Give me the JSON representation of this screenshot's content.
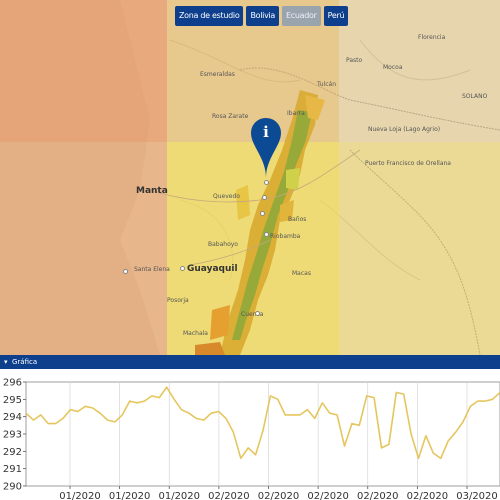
{
  "tabs": [
    {
      "label": "Zona de estudio",
      "active": false
    },
    {
      "label": "Bolivia",
      "active": false
    },
    {
      "label": "Ecuador",
      "active": true
    },
    {
      "label": "Perú",
      "active": false
    }
  ],
  "pin": {
    "label": "i"
  },
  "places": {
    "florencia": "Florencia",
    "mocoa": "Mocoa",
    "pasto": "Pasto",
    "solano": "SOLANO",
    "esmeraldas": "Esmeraldas",
    "tulcan": "Tulcán",
    "ibarra": "Ibarra",
    "rosa_zarate": "Rosa Zarate",
    "nueva_loja": "Nueva Loja (Lago Agrio)",
    "pto_orellana": "Puerto Francisco de Orellana",
    "manta": "Manta",
    "quevedo": "Quevedo",
    "banos": "Baños",
    "riobamba": "Riobamba",
    "babahoyo": "Babahoyo",
    "guayaquil": "Guayaquil",
    "santa_elena": "Santa Elena",
    "macas": "Macas",
    "posorja": "Posorja",
    "cuenca": "Cuenca",
    "machala": "Machala"
  },
  "panel": {
    "toggle": "▾",
    "title": "Gráfica"
  },
  "chart_data": {
    "type": "line",
    "color": "#e5c65e",
    "ylim": [
      290,
      296
    ],
    "yticks": [
      290,
      291,
      292,
      293,
      294,
      295,
      296
    ],
    "xtick_labels": [
      "01/2020",
      "01/2020",
      "01/2020",
      "02/2020",
      "02/2020",
      "02/2020",
      "02/2020",
      "02/2020",
      "03/2020"
    ],
    "values": [
      294.2,
      293.8,
      294.1,
      293.6,
      293.6,
      293.9,
      294.4,
      294.3,
      294.6,
      294.5,
      294.2,
      293.8,
      293.7,
      294.1,
      294.9,
      294.8,
      294.9,
      295.2,
      295.1,
      295.7,
      295.0,
      294.4,
      294.2,
      293.9,
      293.8,
      294.2,
      294.3,
      293.9,
      293.1,
      291.6,
      292.2,
      291.8,
      293.2,
      295.2,
      295.0,
      294.1,
      294.1,
      294.1,
      294.4,
      293.9,
      294.8,
      294.2,
      294.1,
      292.3,
      293.6,
      293.5,
      295.2,
      295.1,
      292.2,
      292.4,
      295.4,
      295.3,
      293.0,
      291.6,
      292.9,
      291.9,
      291.6,
      292.6,
      293.1,
      293.7,
      294.6,
      294.9,
      294.9,
      295.0,
      295.4
    ]
  }
}
